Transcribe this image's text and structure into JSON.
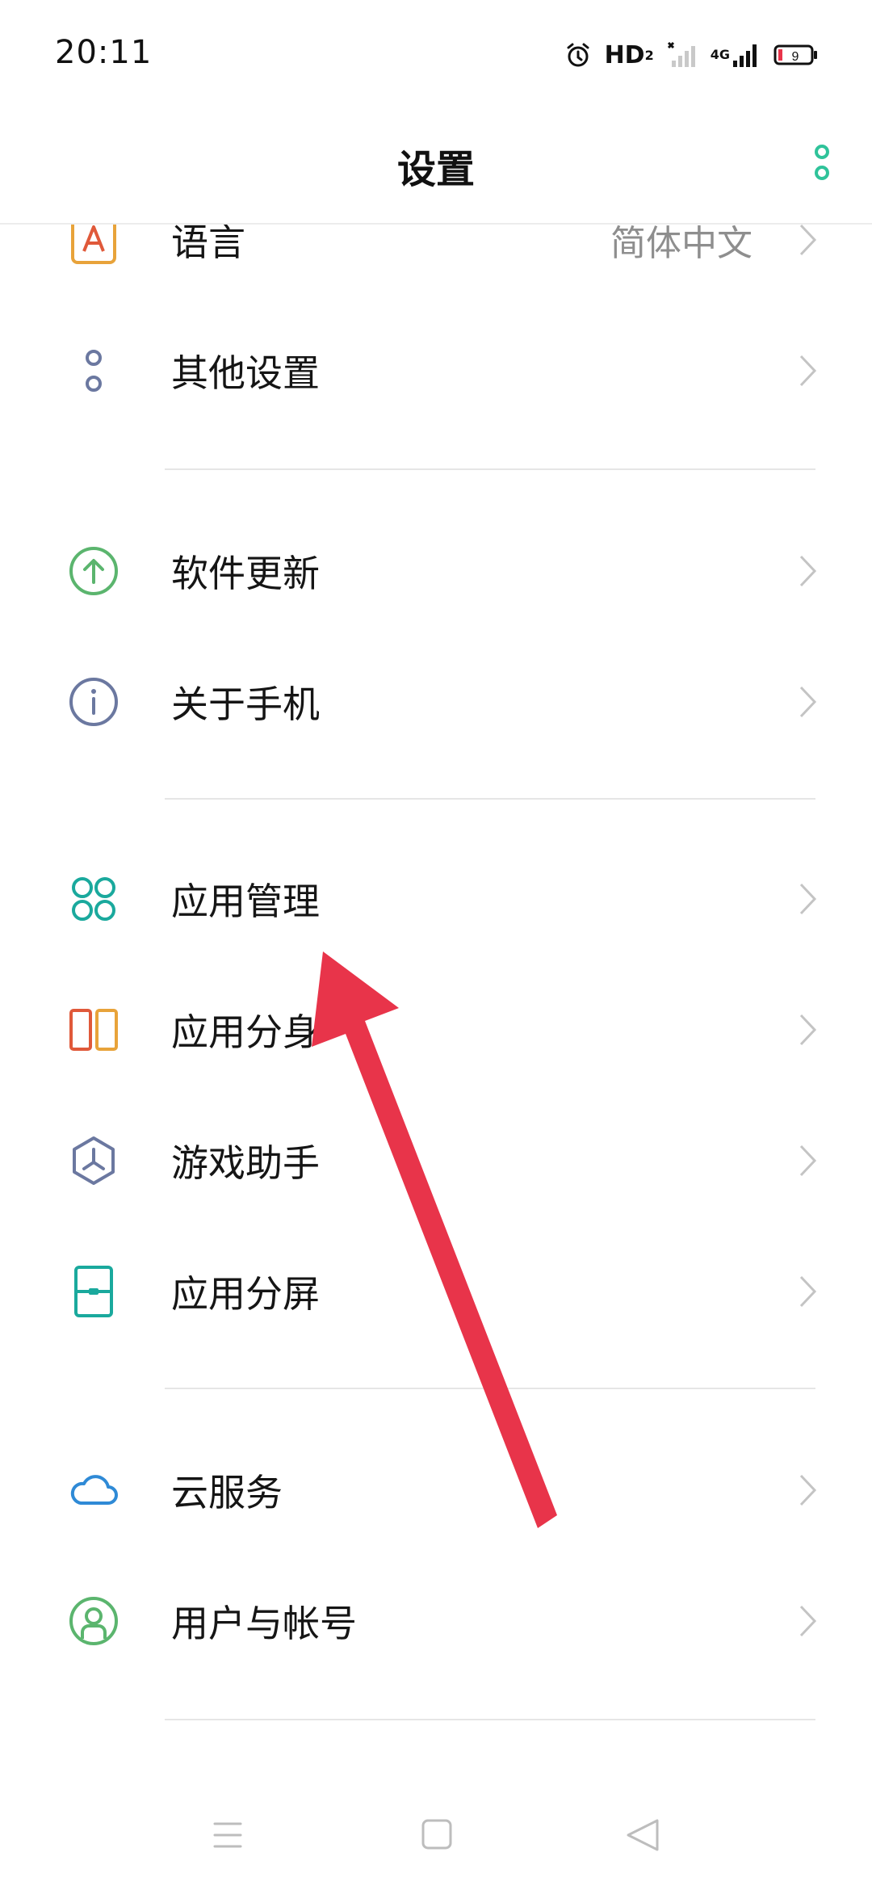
{
  "status_bar": {
    "time": "20:11",
    "hd_label": "HD",
    "hd_sub": "2",
    "network_label": "4G",
    "battery_level": "9"
  },
  "header": {
    "title": "设置"
  },
  "rows": [
    {
      "label": "语言",
      "value": "简体中文",
      "icon": "language-icon",
      "color": "#e8a33a"
    },
    {
      "label": "其他设置",
      "icon": "more-settings-icon",
      "color": "#6b78a0"
    },
    {
      "label": "软件更新",
      "icon": "upload-circle-icon",
      "color": "#5bb56e"
    },
    {
      "label": "关于手机",
      "icon": "info-circle-icon",
      "color": "#6b78a0"
    },
    {
      "label": "应用管理",
      "icon": "app-grid-icon",
      "color": "#1aa99d"
    },
    {
      "label": "应用分身",
      "icon": "app-clone-icon",
      "color": "#e07a3a"
    },
    {
      "label": "游戏助手",
      "icon": "game-assistant-icon",
      "color": "#6b78a0"
    },
    {
      "label": "应用分屏",
      "icon": "split-screen-icon",
      "color": "#1aa99d"
    },
    {
      "label": "云服务",
      "icon": "cloud-icon",
      "color": "#2f8ad6"
    },
    {
      "label": "用户与帐号",
      "icon": "user-account-icon",
      "color": "#5bb56e"
    }
  ],
  "accent_color": "#2fc39a",
  "annotation_arrow_color": "#e8344a"
}
